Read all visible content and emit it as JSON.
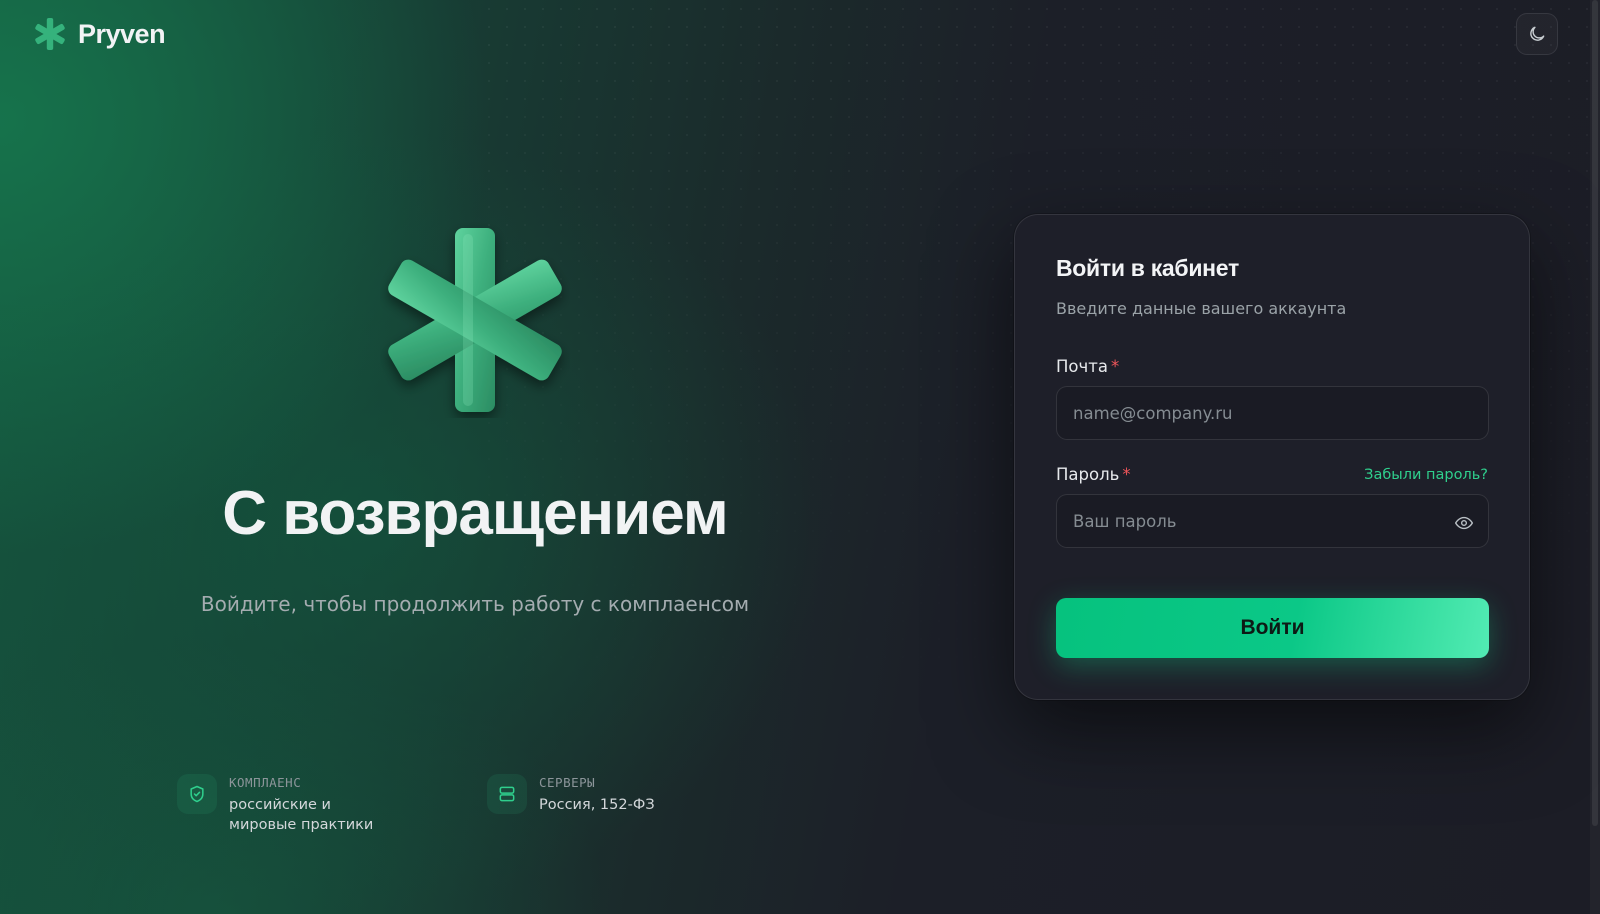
{
  "header": {
    "brand": "Pryven",
    "theme_toggle_icon": "moon-icon"
  },
  "hero": {
    "title": "С возвращением",
    "subtitle": "Войдите, чтобы продолжить работу с комплаенсом"
  },
  "features": [
    {
      "icon": "shield-check-icon",
      "kicker": "КОМПЛАЕНС",
      "value_line1": "российские и",
      "value_line2": "мировые практики"
    },
    {
      "icon": "server-icon",
      "kicker": "СЕРВЕРЫ",
      "value_line1": "Россия, 152-ФЗ"
    }
  ],
  "login": {
    "title": "Войти в кабинет",
    "subtitle": "Введите данные вашего аккаунта",
    "email_label": "Почта",
    "email_placeholder": "name@company.ru",
    "email_value": "",
    "password_label": "Пароль",
    "password_placeholder": "Ваш пароль",
    "password_value": "",
    "forgot_link": "Забыли пароль?",
    "required_mark": "*",
    "submit_label": "Войти"
  },
  "colors": {
    "accent": "#0bc887",
    "accent_light": "#52ebb4",
    "required": "#f0565a",
    "link": "#2fcf8d",
    "background": "#1c1d26"
  }
}
